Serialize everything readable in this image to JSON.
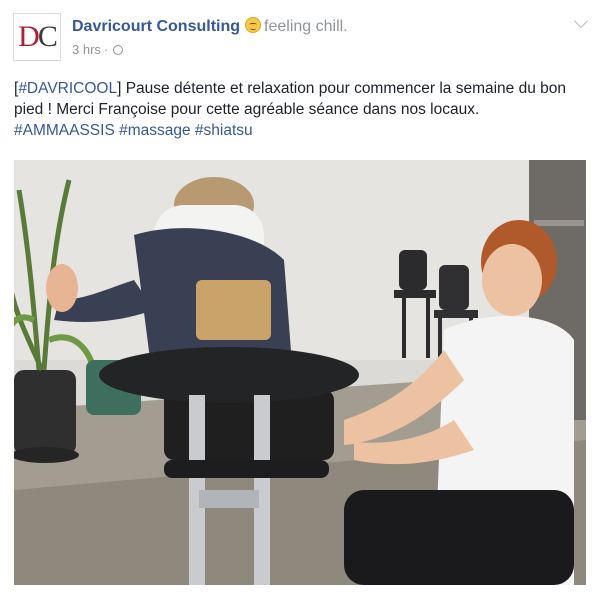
{
  "page": {
    "name": "Davricourt Consulting",
    "avatar": {
      "letter1": "D",
      "letter2": "C"
    },
    "feeling": "feeling chill."
  },
  "meta": {
    "time": "3 hrs",
    "separator": "·"
  },
  "post": {
    "tag_open": "[",
    "hashtag_main": "#DAVRICOOL",
    "tag_close": "]",
    "text": " Pause détente et relaxation pour commencer la semaine du bon pied ! Merci Françoise pour cette agréable séance dans nos locaux.",
    "hashtags": [
      "#AMMAASSIS",
      "#massage",
      "#shiatsu"
    ]
  },
  "colors": {
    "link": "#365899",
    "meta": "#90949c",
    "logo_red": "#b01f2e"
  }
}
